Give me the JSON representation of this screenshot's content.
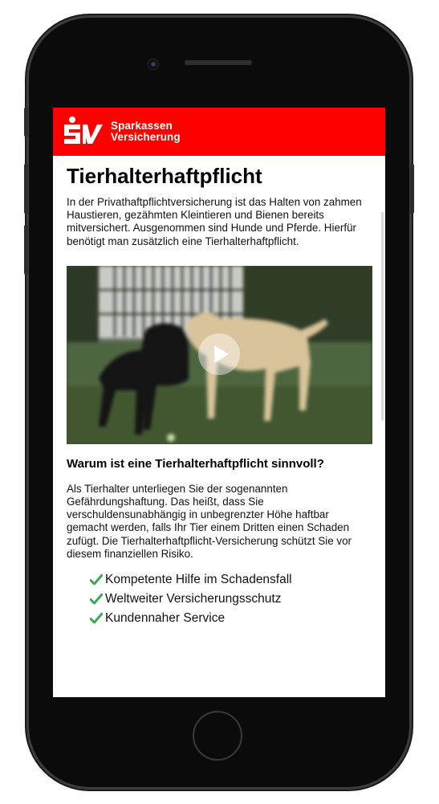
{
  "brand": {
    "line1": "Sparkassen",
    "line2": "Versicherung",
    "logo_color": "#ff0000"
  },
  "page": {
    "title": "Tierhalterhaftpflicht",
    "intro": "In der Privathaftpflichtversicherung ist das Halten von zahmen Haustieren, gezähmten Kleintieren und Bienen bereits mitversichert. Ausgenommen sind Hunde und Pferde. Hierfür benötigt man zusätzlich eine Tierhalterhaftpflicht.",
    "video_icon": "play-icon",
    "subheading": "Warum ist eine Tierhalterhaftpflicht sinnvoll?",
    "body": "Als Tierhalter unterliegen Sie der sogenannten Gefährdungshaftung. Das heißt, dass Sie verschuldensunabhängig in unbegrenzter Höhe haftbar gemacht werden, falls Ihr Tier einem Dritten einen Schaden zufügt. Die Tierhalterhaftpflicht-Versicherung schützt Sie vor diesem finanziellen Risiko.",
    "features": [
      "Kompetente Hilfe im Schadensfall",
      "Weltweiter Versicherungsschutz",
      "Kundennaher Service"
    ],
    "check_icon": "checkmark-icon",
    "check_color": "#3aa857"
  }
}
